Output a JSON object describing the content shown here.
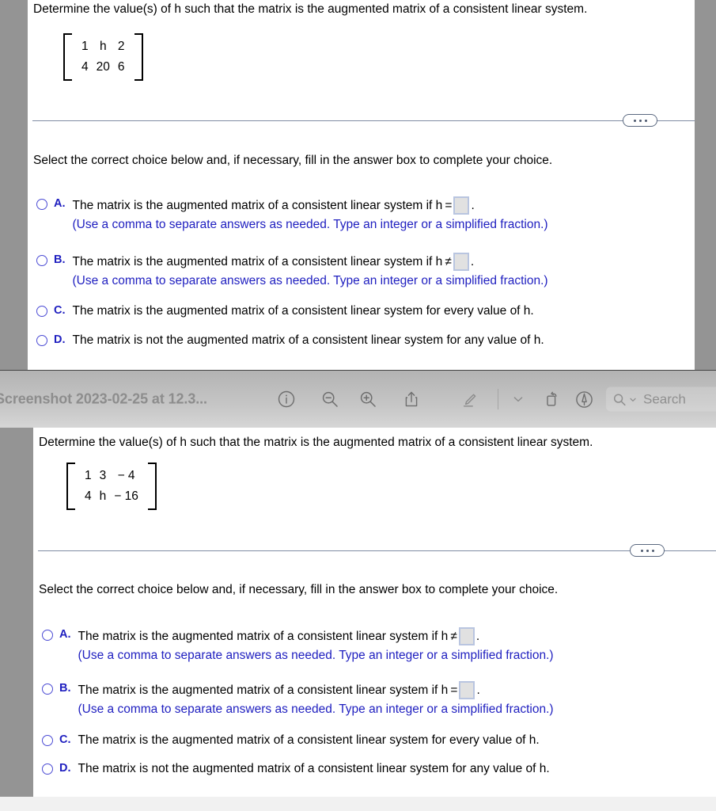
{
  "top_panel": {
    "question": "Determine the value(s) of h such that the matrix is the augmented matrix of a consistent linear system.",
    "matrix": {
      "rows": [
        [
          "1",
          "h",
          "2"
        ],
        [
          "4",
          "20",
          "6"
        ]
      ]
    },
    "prompt": "Select the correct choice below and, if necessary, fill in the answer box to complete your choice.",
    "choices": [
      {
        "letter": "A.",
        "text_before": "The matrix is the augmented matrix of a consistent linear system if h =",
        "has_box": true,
        "box_value": "",
        "text_after": ".",
        "hint": "(Use a comma to separate answers as needed. Type an integer or a simplified fraction.)"
      },
      {
        "letter": "B.",
        "text_before": "The matrix is the augmented matrix of a consistent linear system if h ≠",
        "has_box": true,
        "box_value": "",
        "text_after": ".",
        "hint": "(Use a comma to separate answers as needed. Type an integer or a simplified fraction.)"
      },
      {
        "letter": "C.",
        "text_before": "The matrix is the augmented matrix of a consistent linear system for every value of h.",
        "has_box": false,
        "box_value": "",
        "text_after": "",
        "hint": ""
      },
      {
        "letter": "D.",
        "text_before": "The matrix is not the augmented matrix of a consistent linear system for any value of h.",
        "has_box": false,
        "box_value": "",
        "text_after": "",
        "hint": ""
      }
    ]
  },
  "toolbar": {
    "title": "Screenshot 2023-02-25 at 12.3...",
    "search_placeholder": "Search",
    "icons": [
      "info-icon",
      "zoom-out-icon",
      "zoom-in-icon",
      "share-icon",
      "markup-pen-icon",
      "chevron-down-icon",
      "rotate-icon",
      "annotate-icon",
      "search-icon"
    ]
  },
  "bottom_panel": {
    "question": "Determine the value(s) of h such that the matrix is the augmented matrix of a consistent linear system.",
    "matrix": {
      "rows": [
        [
          "1",
          "3",
          "− 4"
        ],
        [
          "4",
          "h",
          "− 16"
        ]
      ]
    },
    "prompt": "Select the correct choice below and, if necessary, fill in the answer box to complete your choice.",
    "choices": [
      {
        "letter": "A.",
        "text_before": "The matrix is the augmented matrix of a consistent linear system if h ≠",
        "has_box": true,
        "box_value": "",
        "text_after": ".",
        "hint": "(Use a comma to separate answers as needed. Type an integer or a simplified fraction.)"
      },
      {
        "letter": "B.",
        "text_before": "The matrix is the augmented matrix of a consistent linear system if h =",
        "has_box": true,
        "box_value": "",
        "text_after": ".",
        "hint": "(Use a comma to separate answers as needed. Type an integer or a simplified fraction.)"
      },
      {
        "letter": "C.",
        "text_before": "The matrix is the augmented matrix of a consistent linear system for every value of h.",
        "has_box": false,
        "box_value": "",
        "text_after": "",
        "hint": ""
      },
      {
        "letter": "D.",
        "text_before": "The matrix is not the augmented matrix of a consistent linear system for any value of h.",
        "has_box": false,
        "box_value": "",
        "text_after": "",
        "hint": ""
      }
    ]
  },
  "colors": {
    "accent_blue": "#2020c0",
    "radio_blue": "#4a4ad4",
    "gutter_gray": "#949494",
    "divider": "#7f8ba3",
    "answer_box_fill": "#e1e1e1",
    "answer_box_border": "#b9c5e0"
  }
}
